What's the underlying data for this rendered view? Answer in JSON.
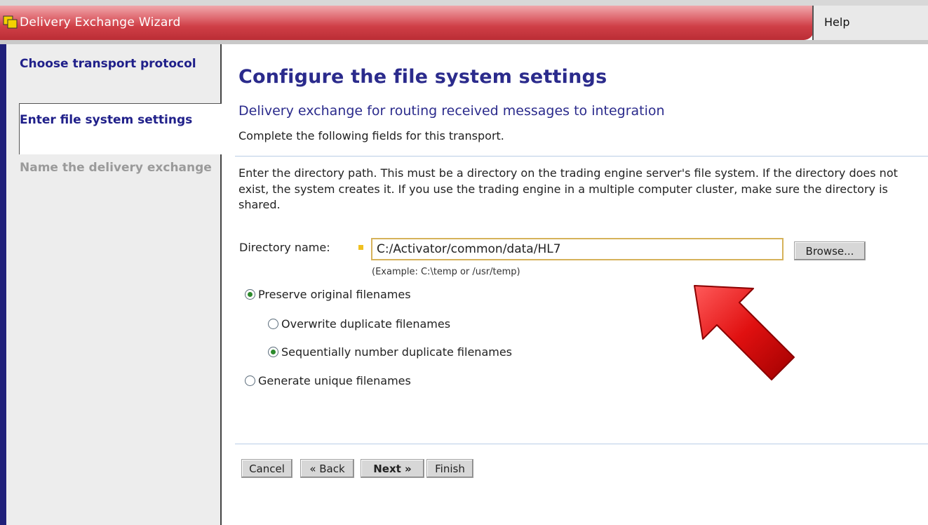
{
  "window": {
    "title": "Delivery Exchange Wizard",
    "help": "Help"
  },
  "sidebar": {
    "steps": [
      {
        "label": "Choose transport protocol",
        "state": "done"
      },
      {
        "label": "Enter file system settings",
        "state": "current"
      },
      {
        "label": "Name the delivery exchange",
        "state": "pending"
      }
    ]
  },
  "main": {
    "title": "Configure the file system settings",
    "subtitle": "Delivery exchange for routing received messages to integration",
    "intro": "Complete the following fields for this transport.",
    "instructions": "Enter the directory path. This must be a directory on the trading engine server's file system. If the directory does not exist, the system creates it. If you use the trading engine in a multiple computer cluster, make sure the directory is shared.",
    "directory": {
      "label": "Directory name:",
      "value": "C:/Activator/common/data/HL7",
      "browse": "Browse...",
      "example": "(Example: C:\\temp or /usr/temp)"
    },
    "options": {
      "preserve": {
        "label": "Preserve original filenames",
        "checked": true
      },
      "overwrite": {
        "label": "Overwrite duplicate filenames",
        "checked": false
      },
      "sequential": {
        "label": "Sequentially number duplicate filenames",
        "checked": true
      },
      "generate": {
        "label": "Generate unique filenames",
        "checked": false
      }
    }
  },
  "buttons": {
    "cancel": "Cancel",
    "back": "« Back",
    "next": "Next »",
    "finish": "Finish"
  },
  "colors": {
    "titlebar": "#cf3f47",
    "heading": "#2b2b8c",
    "sidebar_rule": "#20207a",
    "arrow": "#e01010"
  }
}
